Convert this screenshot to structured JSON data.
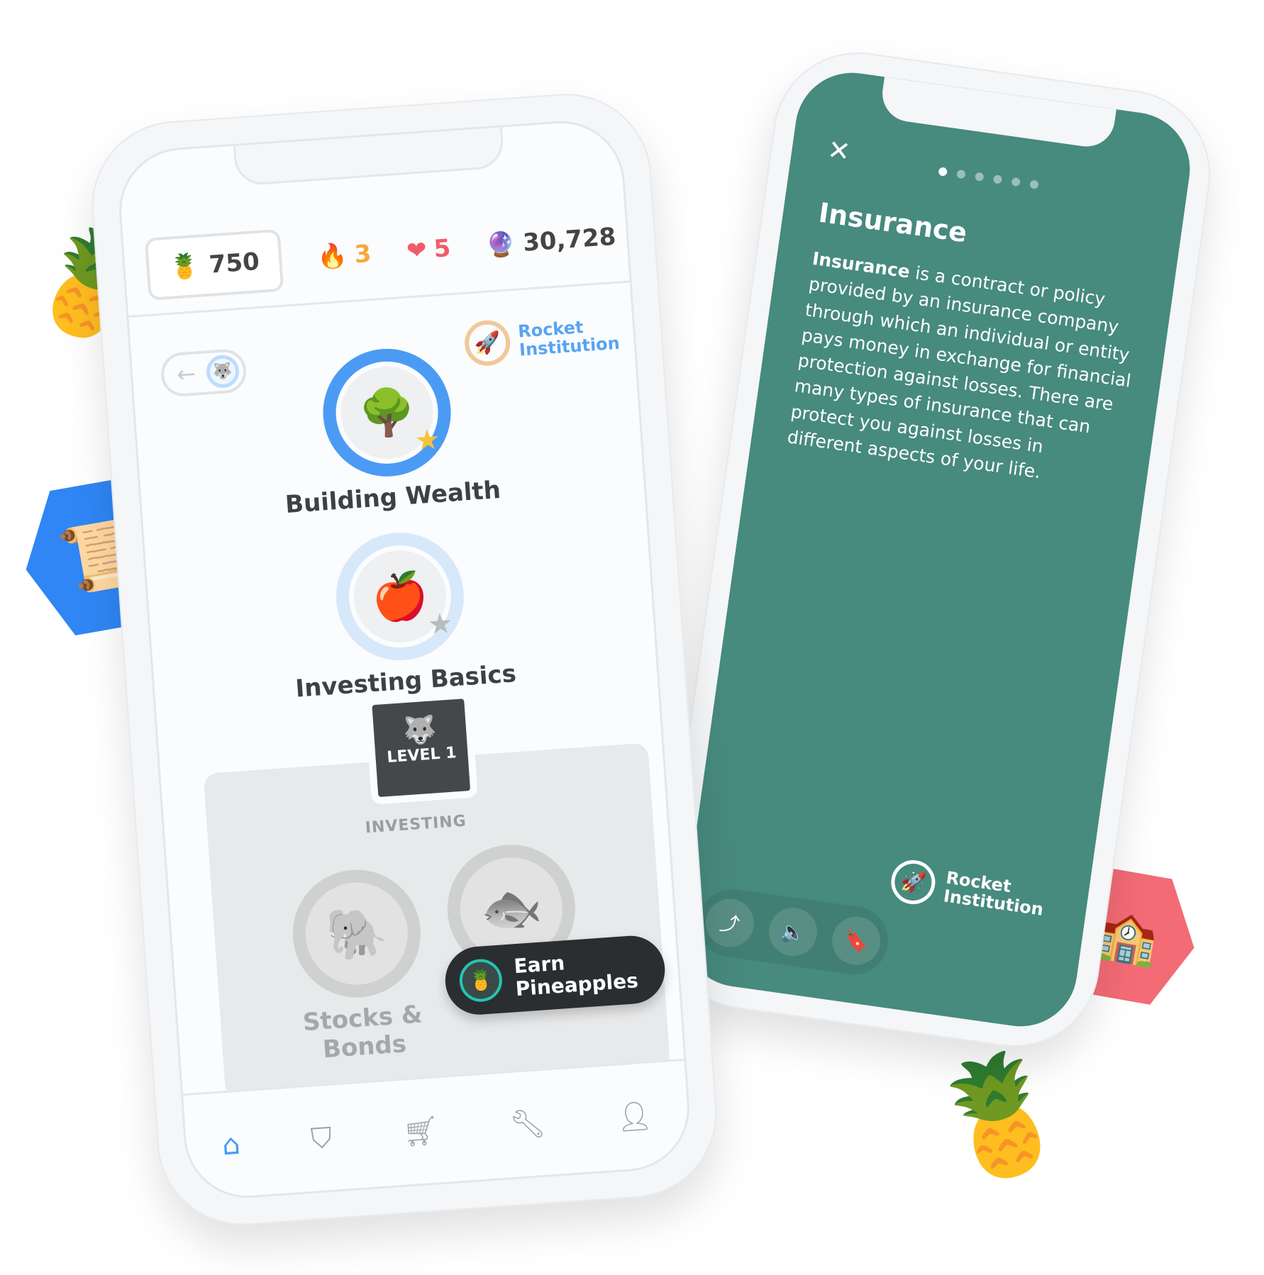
{
  "left_phone": {
    "stats": {
      "pineapples": "750",
      "streak": "3",
      "hearts": "5",
      "gems": "30,728"
    },
    "sponsor": {
      "line1": "Rocket",
      "line2": "Institution"
    },
    "lessons": [
      {
        "label": "Building Wealth",
        "icon": "tree-icon",
        "complete": true
      },
      {
        "label": "Investing Basics",
        "icon": "apple-icon",
        "complete": false
      }
    ],
    "level_badge": "LEVEL 1",
    "section_title": "INVESTING",
    "locked_lessons": [
      {
        "label": "Stocks & Bonds",
        "icon": "elephant-icon"
      },
      {
        "label": "",
        "icon": "fish-icon"
      }
    ],
    "earn_button": {
      "line1": "Earn",
      "line2": "Pineapples"
    },
    "nav": [
      "home",
      "shield",
      "cart",
      "wrench",
      "profile"
    ]
  },
  "right_phone": {
    "title": "Insurance",
    "body_bold": "Insurance",
    "body_rest": " is a contract or policy provided by an insurance company through which an individual or entity pays money in exchange for financial protection against losses. There are many types of insurance that can protect you against losses in different aspects of your life.",
    "page_dots": 6,
    "active_dot": 1,
    "sponsor": {
      "line1": "Rocket",
      "line2": "Institution"
    },
    "actions": [
      "share",
      "audio",
      "bookmark"
    ]
  },
  "colors": {
    "accent": "#4b9bf5",
    "card_green": "#478a7e",
    "streak": "#f7a73b",
    "heart": "#f25b6a"
  }
}
